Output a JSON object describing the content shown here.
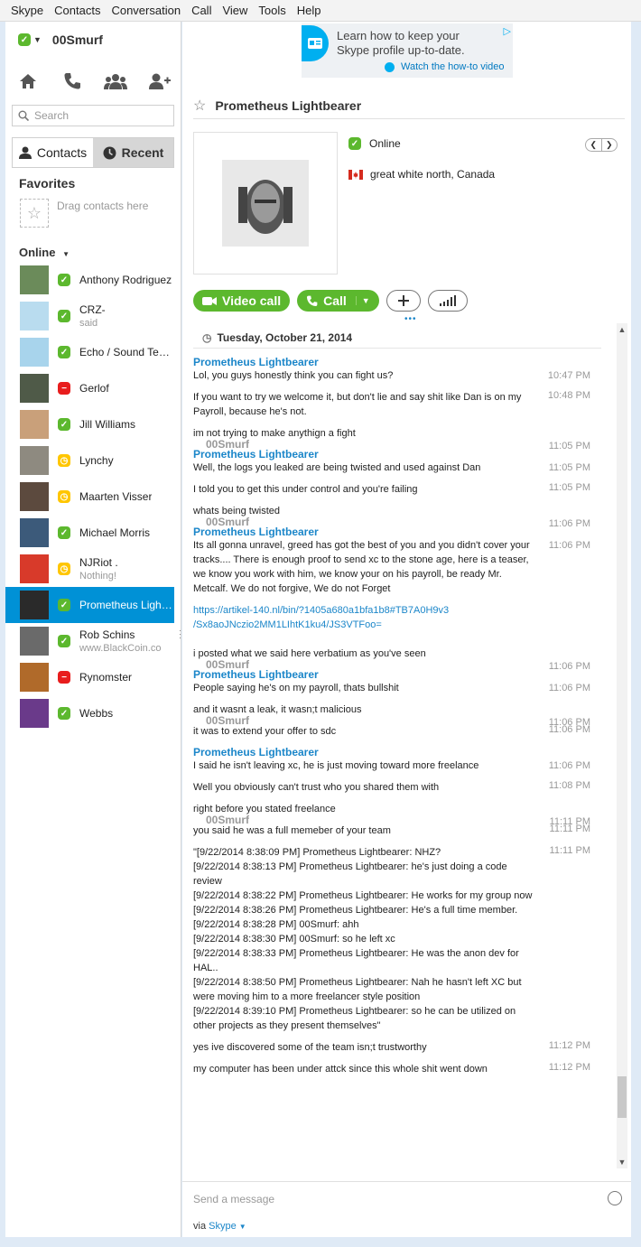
{
  "menu": [
    "Skype",
    "Contacts",
    "Conversation",
    "Call",
    "View",
    "Tools",
    "Help"
  ],
  "me": {
    "name": "00Smurf",
    "status": "online"
  },
  "search": {
    "placeholder": "Search"
  },
  "tabs": {
    "contacts": "Contacts",
    "recent": "Recent"
  },
  "favorites": {
    "title": "Favorites",
    "hint": "Drag contacts here"
  },
  "online_header": "Online",
  "contacts": [
    {
      "name": "Anthony Rodriguez",
      "mood": "",
      "status": "online",
      "avatar_color": "#6b8b5a"
    },
    {
      "name": "CRZ-",
      "mood": "said",
      "status": "online",
      "avatar_color": "#b9dcef"
    },
    {
      "name": "Echo / Sound Test...",
      "mood": "",
      "status": "online",
      "avatar_color": "#a8d4ec"
    },
    {
      "name": "Gerlof",
      "mood": "",
      "status": "busy",
      "avatar_color": "#4f5a48"
    },
    {
      "name": "Jill Williams",
      "mood": "",
      "status": "online",
      "avatar_color": "#c9a07a"
    },
    {
      "name": "Lynchy",
      "mood": "",
      "status": "away",
      "avatar_color": "#8e8a80"
    },
    {
      "name": "Maarten Visser",
      "mood": "",
      "status": "away",
      "avatar_color": "#5c4a3e"
    },
    {
      "name": "Michael Morris",
      "mood": "",
      "status": "online",
      "avatar_color": "#3c5a7a"
    },
    {
      "name": "NJRiot .",
      "mood": "Nothing!",
      "status": "away",
      "avatar_color": "#d83a2a"
    },
    {
      "name": "Prometheus Lightb...",
      "mood": "",
      "status": "online",
      "avatar_color": "#2a2a2a",
      "selected": true
    },
    {
      "name": "Rob Schins",
      "mood": "www.BlackCoin.co",
      "status": "online",
      "avatar_color": "#6a6a6a"
    },
    {
      "name": "Rynomster",
      "mood": "",
      "status": "busy",
      "avatar_color": "#b06a2a"
    },
    {
      "name": "Webbs",
      "mood": "",
      "status": "online",
      "avatar_color": "#6a3a8a"
    }
  ],
  "ad": {
    "line1": "Learn how to keep your",
    "line2": "Skype profile up-to-date.",
    "link": "Watch the how-to video"
  },
  "conversation": {
    "title": "Prometheus Lightbearer",
    "status": "Online",
    "location": "great white north, Canada",
    "video_call": "Video call",
    "call": "Call"
  },
  "chat": {
    "date": "Tuesday, October 21, 2014",
    "messages": [
      {
        "sender": "Prometheus Lightbearer",
        "me": false,
        "text": "Lol, you guys honestly think you can fight us?",
        "time": "10:47 PM"
      },
      {
        "sender": "",
        "me": false,
        "text": "If you want to try we welcome it, but don't lie and say shit like Dan is on my Payroll, because he's not.",
        "time": "10:48 PM"
      },
      {
        "sender": "00Smurf",
        "me": true,
        "text": "im not trying to make anythign a fight",
        "time": "11:05 PM"
      },
      {
        "sender": "Prometheus Lightbearer",
        "me": false,
        "text": "Well, the logs you leaked are being twisted and used against Dan",
        "time": "11:05 PM"
      },
      {
        "sender": "",
        "me": false,
        "text": "I told you to get this under control and you're failing",
        "time": "11:05 PM"
      },
      {
        "sender": "00Smurf",
        "me": true,
        "text": "whats being twisted",
        "time": "11:06 PM"
      },
      {
        "sender": "Prometheus Lightbearer",
        "me": false,
        "text": "Its all gonna unravel, greed has got the best of you and you didn't cover your tracks.... There is enough proof to send xc to the stone age, here is a teaser, we know you work with him, we know your on his payroll, be ready Mr. Metcalf. We do not forgive, We do not Forget",
        "time": "11:06 PM"
      },
      {
        "sender": "",
        "me": false,
        "link": "https://artikel-140.nl/bin/?1405a680a1bfa1b8#TB7A0H9v3\n/Sx8aoJNczio2MM1LIhtK1ku4/JS3VTFoo=",
        "text": "",
        "time": ""
      },
      {
        "sender": "00Smurf",
        "me": true,
        "text": "i posted what we said here verbatium as you've seen",
        "time": "11:06 PM"
      },
      {
        "sender": "Prometheus Lightbearer",
        "me": false,
        "text": "People saying he's on my payroll, thats bullshit",
        "time": "11:06 PM"
      },
      {
        "sender": "00Smurf",
        "me": true,
        "text": "and it wasnt a leak, it wasn;t malicious",
        "time": "11:06 PM"
      },
      {
        "sender": "",
        "me": true,
        "text": "it was to extend your offer to sdc",
        "time": "11:06 PM"
      },
      {
        "sender": "Prometheus Lightbearer",
        "me": false,
        "text": "I said he isn't leaving xc, he is just moving toward more freelance",
        "time": "11:06 PM"
      },
      {
        "sender": "",
        "me": false,
        "text": "Well you obviously can't trust who you shared them with",
        "time": "11:08 PM"
      },
      {
        "sender": "00Smurf",
        "me": true,
        "text": "right before you stated freelance",
        "time": "11:11 PM"
      },
      {
        "sender": "",
        "me": true,
        "text": "you said he was a full memeber of your team",
        "time": "11:11 PM"
      },
      {
        "sender": "",
        "me": true,
        "text": "\"[9/22/2014 8:38:09 PM] Prometheus Lightbearer: NHZ?\n[9/22/2014 8:38:13 PM] Prometheus Lightbearer: he's just doing a code review\n[9/22/2014 8:38:22 PM] Prometheus Lightbearer: He works for my group now\n[9/22/2014 8:38:26 PM] Prometheus Lightbearer: He's a full time member.\n[9/22/2014 8:38:28 PM] 00Smurf: ahh\n[9/22/2014 8:38:30 PM] 00Smurf: so he left xc\n[9/22/2014 8:38:33 PM] Prometheus Lightbearer: He was the anon dev for HAL..\n[9/22/2014 8:38:50 PM] Prometheus Lightbearer: Nah he hasn't left XC but were moving him to a more freelancer style position\n[9/22/2014 8:39:10 PM] Prometheus Lightbearer: so he can be utilized on other projects as they present themselves\"",
        "time": "11:11 PM"
      },
      {
        "sender": "",
        "me": true,
        "text": "yes ive discovered some of the team isn;t trustworthy",
        "time": "11:12 PM"
      },
      {
        "sender": "",
        "me": true,
        "text": "my computer has been under attck since this whole shit went down",
        "time": "11:12 PM"
      }
    ]
  },
  "composer": {
    "placeholder": "Send a message",
    "via_prefix": "via",
    "via_brand": "Skype"
  }
}
